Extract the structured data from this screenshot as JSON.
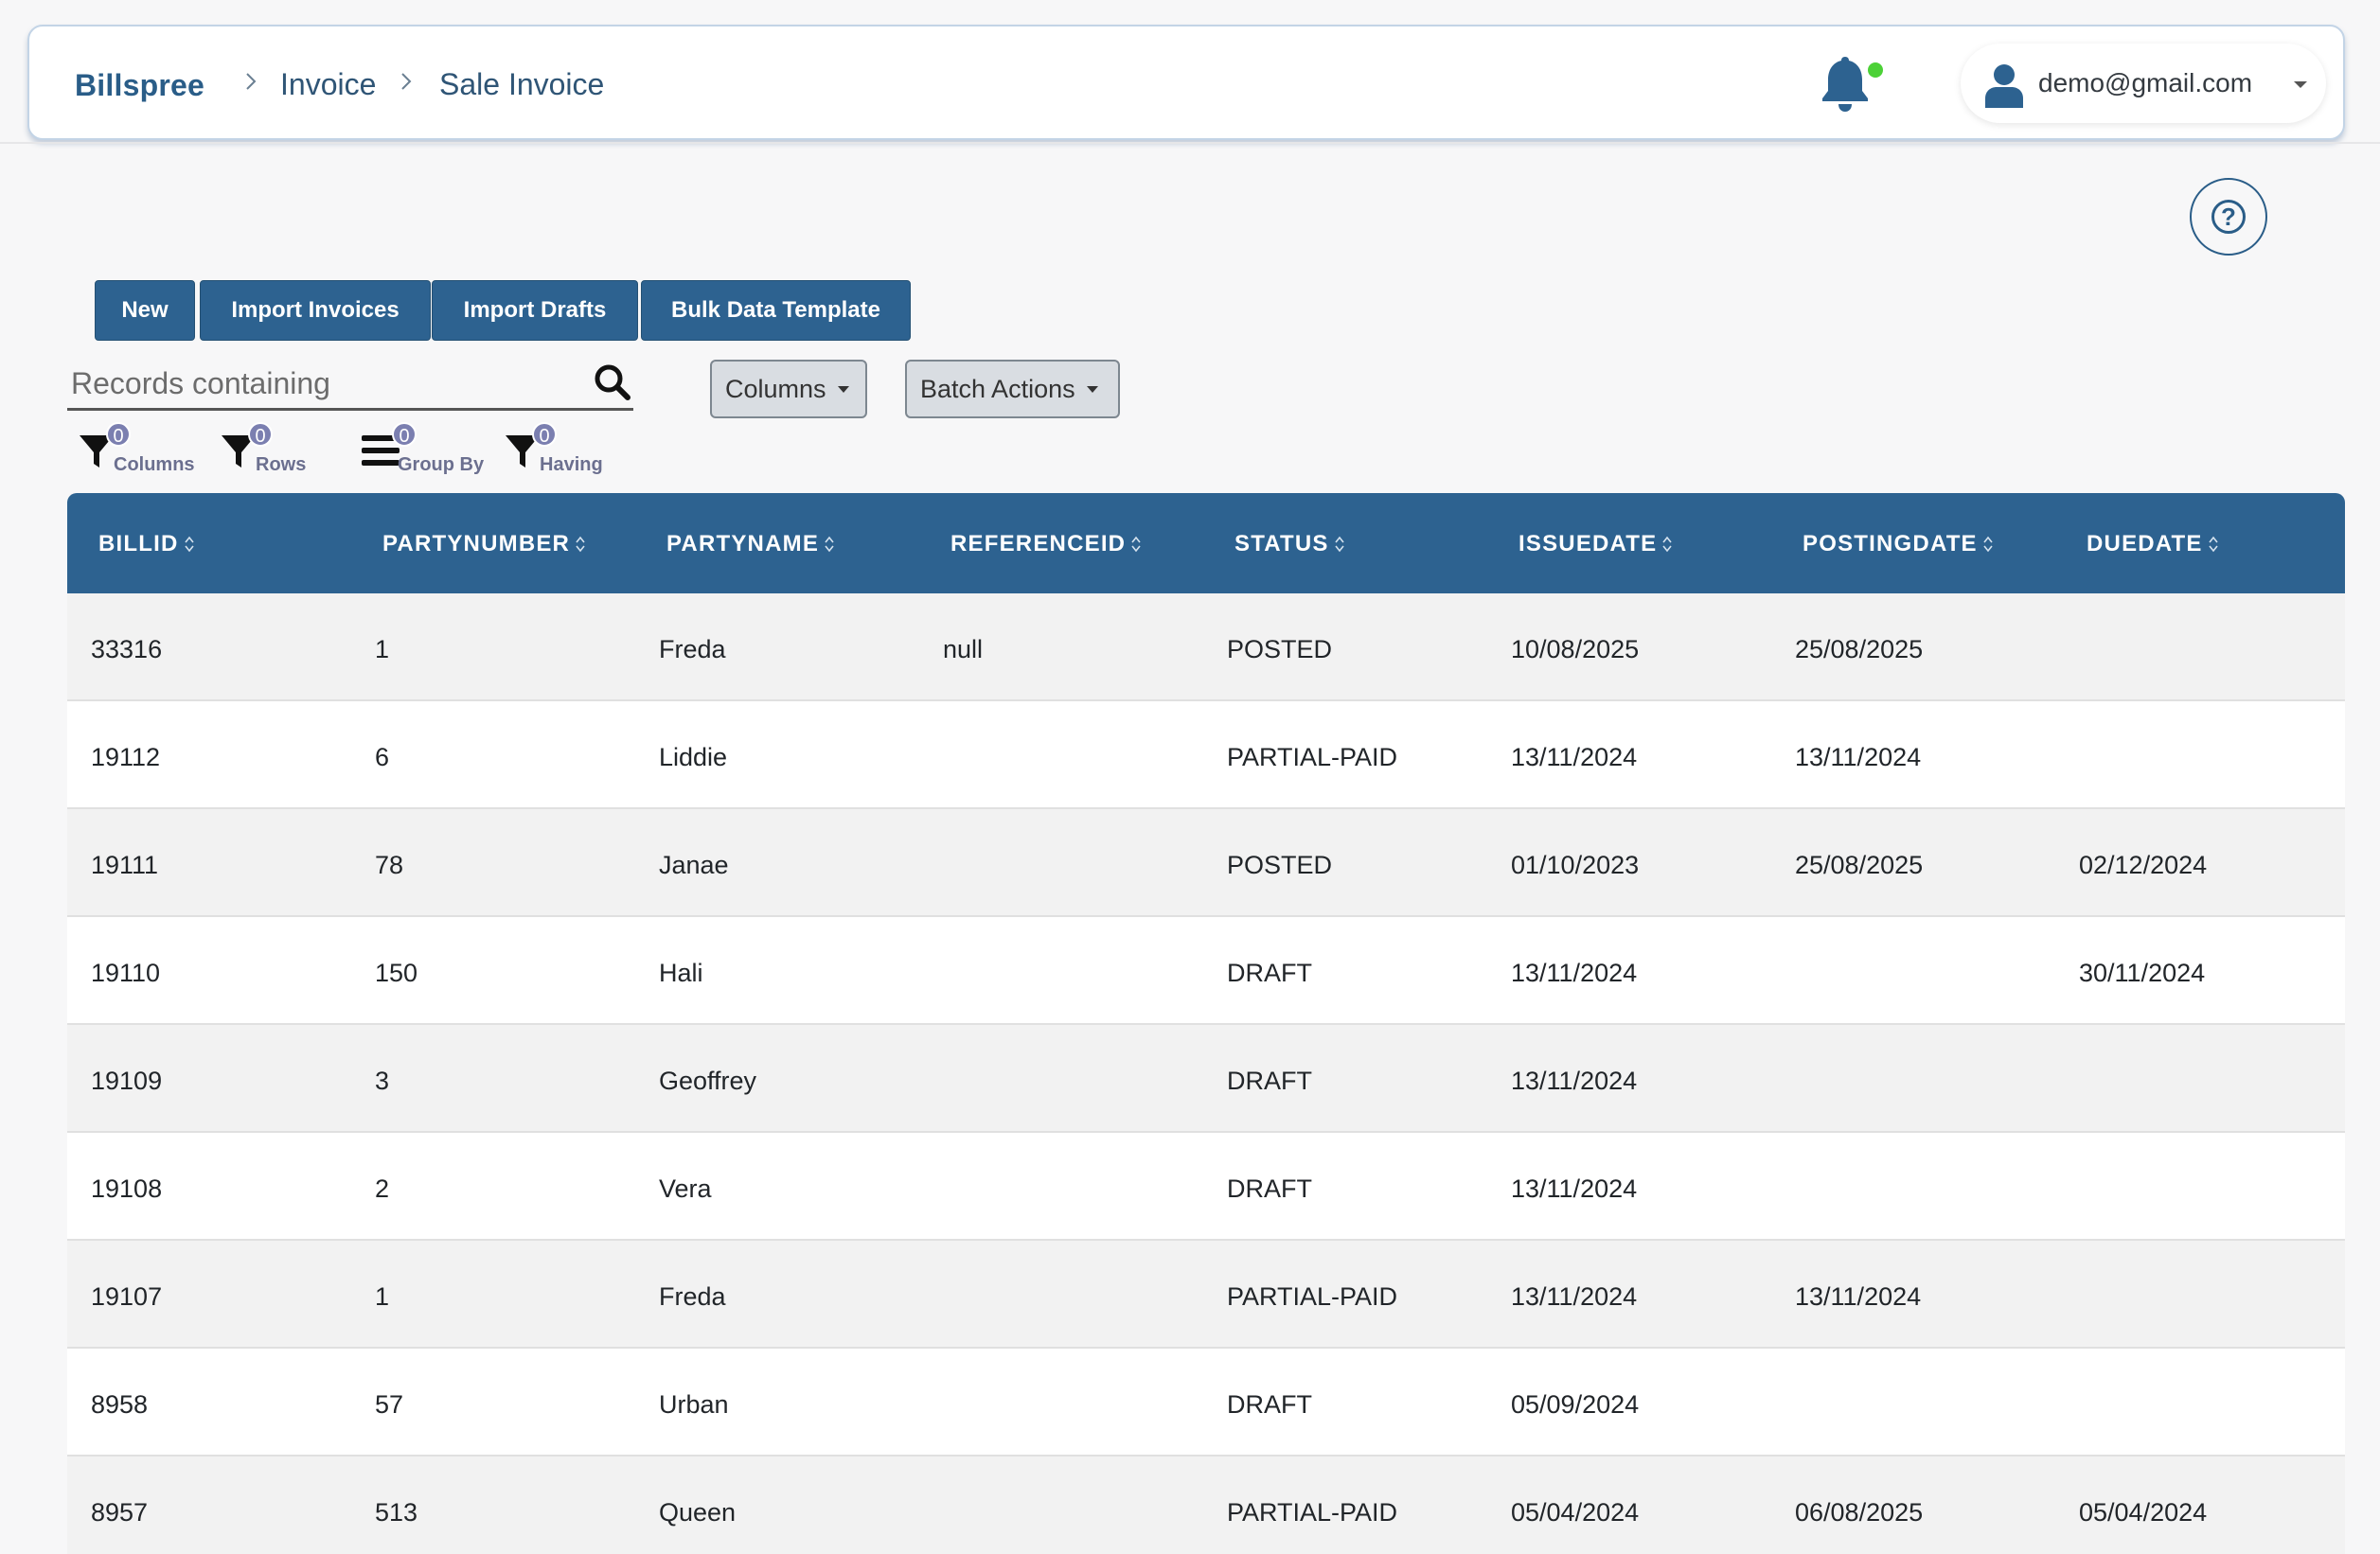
{
  "header": {
    "brand": "Billspree",
    "breadcrumb": [
      "Invoice",
      "Sale Invoice"
    ],
    "user_email": "demo@gmail.com",
    "notification_dot_color": "#4cd137"
  },
  "help": {
    "symbol": "?"
  },
  "actions": {
    "new_label": "New",
    "import_invoices_label": "Import Invoices",
    "import_drafts_label": "Import Drafts",
    "bulk_template_label": "Bulk Data Template"
  },
  "search": {
    "placeholder": "Records containing",
    "value": ""
  },
  "dropdowns": {
    "columns_label": "Columns",
    "batch_actions_label": "Batch Actions"
  },
  "filters": [
    {
      "label": "Columns",
      "count": "0",
      "icon": "filter-icon"
    },
    {
      "label": "Rows",
      "count": "0",
      "icon": "filter-icon"
    },
    {
      "label": "Group By",
      "count": "0",
      "icon": "list-icon"
    },
    {
      "label": "Having",
      "count": "0",
      "icon": "filter-icon"
    }
  ],
  "table": {
    "columns": [
      "BILLID",
      "PARTYNUMBER",
      "PARTYNAME",
      "REFERENCEID",
      "STATUS",
      "ISSUEDATE",
      "POSTINGDATE",
      "DUEDATE"
    ],
    "rows": [
      [
        "33316",
        "1",
        "Freda",
        "null",
        "POSTED",
        "10/08/2025",
        "25/08/2025",
        ""
      ],
      [
        "19112",
        "6",
        "Liddie",
        "",
        "PARTIAL-PAID",
        "13/11/2024",
        "13/11/2024",
        ""
      ],
      [
        "19111",
        "78",
        "Janae",
        "",
        "POSTED",
        "01/10/2023",
        "25/08/2025",
        "02/12/2024"
      ],
      [
        "19110",
        "150",
        "Hali",
        "",
        "DRAFT",
        "13/11/2024",
        "",
        "30/11/2024"
      ],
      [
        "19109",
        "3",
        "Geoffrey",
        "",
        "DRAFT",
        "13/11/2024",
        "",
        ""
      ],
      [
        "19108",
        "2",
        "Vera",
        "",
        "DRAFT",
        "13/11/2024",
        "",
        ""
      ],
      [
        "19107",
        "1",
        "Freda",
        "",
        "PARTIAL-PAID",
        "13/11/2024",
        "13/11/2024",
        ""
      ],
      [
        "8958",
        "57",
        "Urban",
        "",
        "DRAFT",
        "05/09/2024",
        "",
        ""
      ],
      [
        "8957",
        "513",
        "Queen",
        "",
        "PARTIAL-PAID",
        "05/04/2024",
        "06/08/2025",
        "05/04/2024"
      ]
    ]
  },
  "colors": {
    "primary": "#2d6290",
    "brand_text": "#2a5d88"
  }
}
